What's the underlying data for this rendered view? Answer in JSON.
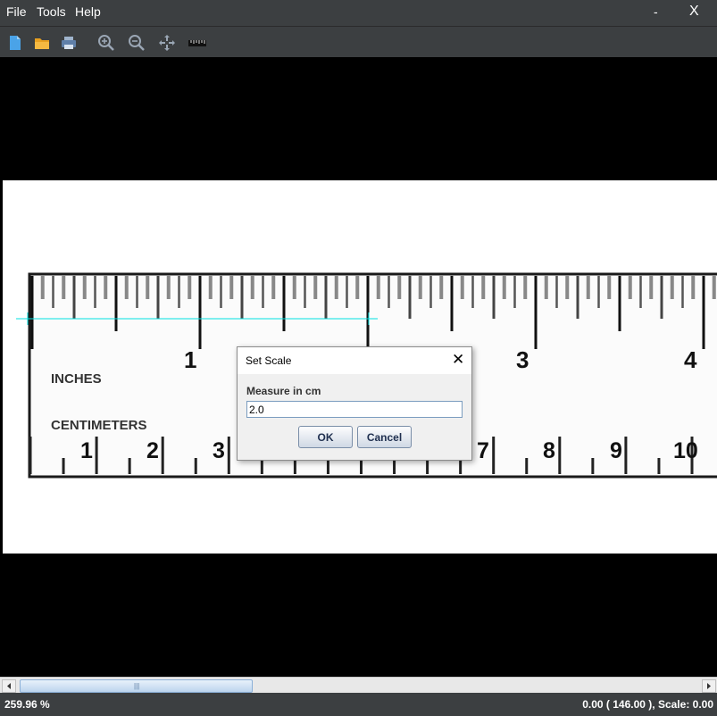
{
  "menubar": {
    "items": [
      "File",
      "Tools",
      "Help"
    ],
    "minimize_label": "-",
    "close_label": "X"
  },
  "toolbar": {
    "buttons": [
      "new-file-icon",
      "open-folder-icon",
      "print-icon",
      "zoom-in-icon",
      "zoom-out-icon",
      "pan-move-icon",
      "ruler-measure-icon"
    ]
  },
  "ruler_image": {
    "inch_numbers": [
      "1",
      "3",
      "4"
    ],
    "cm_numbers": [
      "1",
      "2",
      "3",
      "7",
      "8",
      "9",
      "10"
    ],
    "inches_label": "INCHES",
    "centimeters_label": "CENTIMETERS",
    "measure_line_color": "#00e0e0"
  },
  "dialog": {
    "title": "Set Scale",
    "close_label": "✕",
    "field_label": "Measure in cm",
    "field_value": "2.0",
    "ok_label": "OK",
    "cancel_label": "Cancel"
  },
  "statusbar": {
    "zoom": "259.96 %",
    "coords": "0.00 ( 146.00 ), Scale: 0.00"
  }
}
